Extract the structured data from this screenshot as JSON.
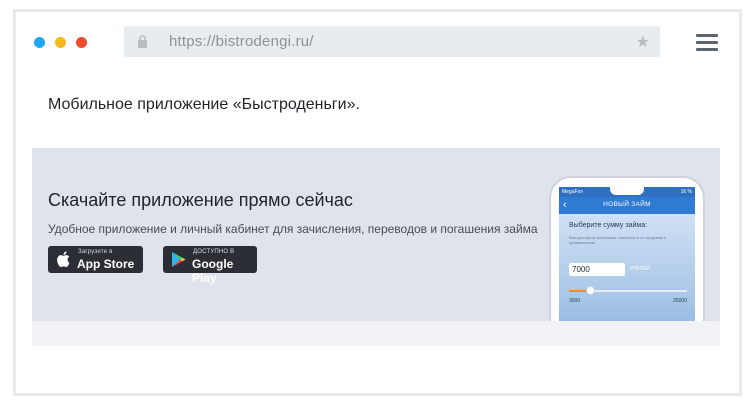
{
  "browser": {
    "url": "https://bistrodengi.ru/",
    "icons": {
      "lock": "lock-icon",
      "bookmark": "star-icon",
      "menu": "hamburger-menu-icon"
    },
    "colors": {
      "dot_blue": "#1ea7f2",
      "dot_yellow": "#f6b91f",
      "dot_red": "#ee4b2b"
    }
  },
  "page": {
    "title": "Мобильное приложение «Быстроденьги»."
  },
  "banner": {
    "heading": "Скачайте приложение прямо сейчас",
    "subtitle": "Удобное приложение и личный кабинет для зачисления, переводов и погашения займа",
    "appstore": {
      "small": "Загрузите в",
      "big": "App Store"
    },
    "googleplay": {
      "small": "ДОСТУПНО В",
      "big": "Google Play"
    }
  },
  "phone": {
    "carrier": "MegaFon",
    "battery": "16 %",
    "nav_title": "НОВЫЙ ЗАЙМ",
    "prompt": "Выберите сумму займа:",
    "fine_print": "Вам доступна программа лояльности со скидками и привилегиями",
    "amount": "7000",
    "currency": "РУБЛЕЙ",
    "slider_min": "3000",
    "slider_max": "25000",
    "slider_fraction": 0.18
  }
}
